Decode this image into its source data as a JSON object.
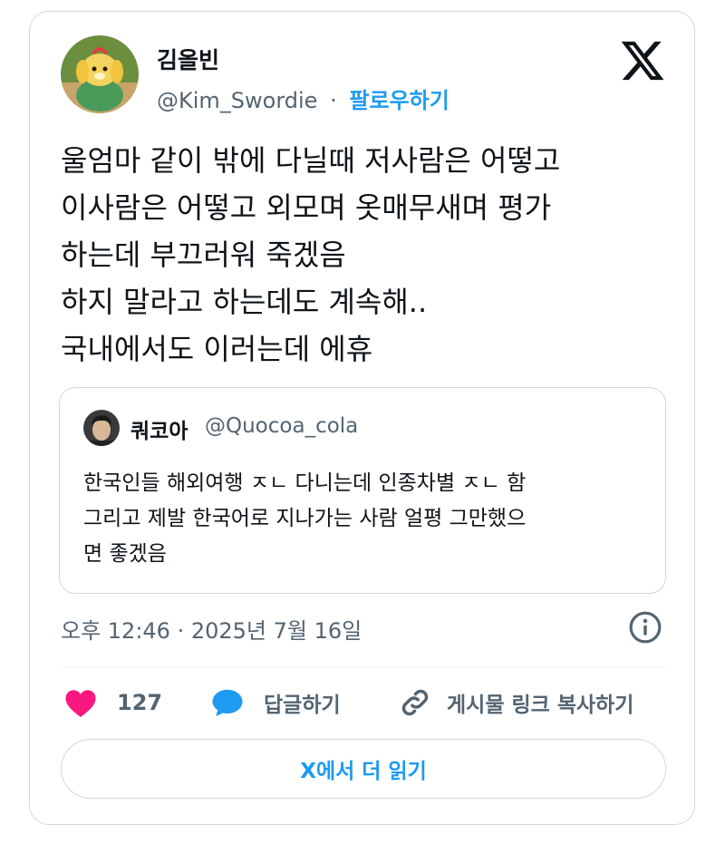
{
  "author": {
    "display_name": "김올빈",
    "handle": "@Kim_Swordie",
    "separator": "·",
    "follow_label": "팔로우하기"
  },
  "tweet": {
    "lines": [
      "울엄마 같이 밖에 다닐때 저사람은 어떻고",
      "이사람은 어떻고 외모며 옷매무새며 평가",
      "하는데 부끄러워 죽겠음",
      "하지 말라고 하는데도 계속해..",
      "국내에서도 이러는데 에휴"
    ]
  },
  "quoted_tweet": {
    "display_name": "쿼코아",
    "handle": "@Quocoa_cola",
    "lines": [
      "한국인들 해외여행 ㅈㄴ 다니는데 인종차별 ㅈㄴ 함",
      "그리고 제발 한국어로 지나가는 사람 얼평 그만했으",
      "면 좋겠음"
    ]
  },
  "timestamp": "오후 12:46 · 2025년 7월 16일",
  "actions": {
    "like_count": "127",
    "reply_label": "답글하기",
    "copy_link_label": "게시물 링크 복사하기"
  },
  "read_more_label": "X에서 더 읽기",
  "colors": {
    "accent": "#1d9bf0",
    "heart": "#f91880",
    "secondary_text": "#536471",
    "border": "#cfd9de"
  },
  "icons": {
    "brand": "x-logo-icon",
    "info": "info-icon",
    "like": "heart-icon",
    "reply": "speech-bubble-icon",
    "copy": "link-icon"
  }
}
